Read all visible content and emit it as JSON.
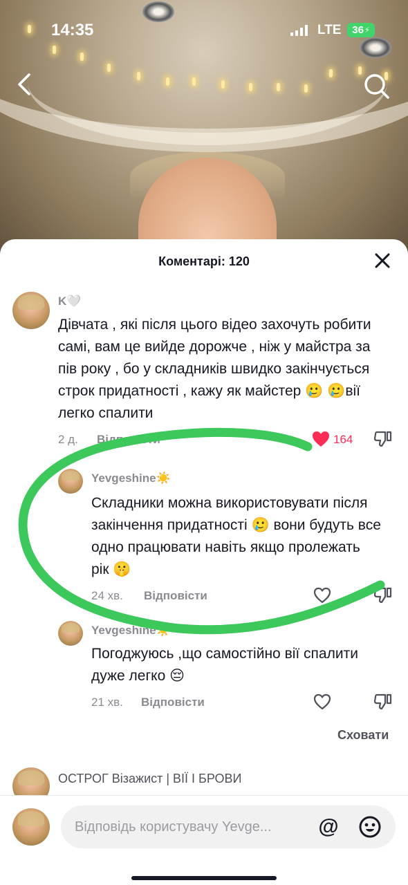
{
  "status_bar": {
    "time": "14:35",
    "network": "LTE",
    "battery": "36"
  },
  "nav": {
    "back_icon": "chevron-left-icon",
    "search_icon": "search-icon"
  },
  "comments_sheet": {
    "title": "Коментарі: 120",
    "close_icon": "close-icon",
    "comments": [
      {
        "author": "K🤍",
        "text": "Дівчата , які після цього відео захочуть робити самі, вам це вийде дорожче , ніж у майстра за пів року , бо у складників швидко закінчується строк придатності , кажу як майстер 🥲 🥲вії легко спалити",
        "time": "2 д.",
        "reply_label": "Відповісти",
        "likes": "164",
        "liked": true
      }
    ],
    "replies": [
      {
        "author": "Yevgeshine☀️",
        "text": "Складники можна використовувати після закінчення придатності 🥲 вони будуть все одно працювати навіть якщо пролежать рік 🤫",
        "time": "24 хв.",
        "reply_label": "Відповісти"
      },
      {
        "author": "Yevgeshine☀️",
        "text": "Погоджуюсь ,що самостійно вії спалити дуже легко 😔",
        "time": "21 хв.",
        "reply_label": "Відповісти"
      }
    ],
    "hide_label": "Сховати",
    "next_comment_author": "ОСТРОГ Візажист | ВІЇ І БРОВИ"
  },
  "reply_bar": {
    "placeholder": "Відповідь користувачу Yevge...",
    "mention_symbol": "@",
    "emoji_icon": "emoji-smile-icon"
  },
  "colors": {
    "like_red": "#fe2c55",
    "annotation_green": "#3cc85a",
    "battery_green": "#43d36b"
  }
}
